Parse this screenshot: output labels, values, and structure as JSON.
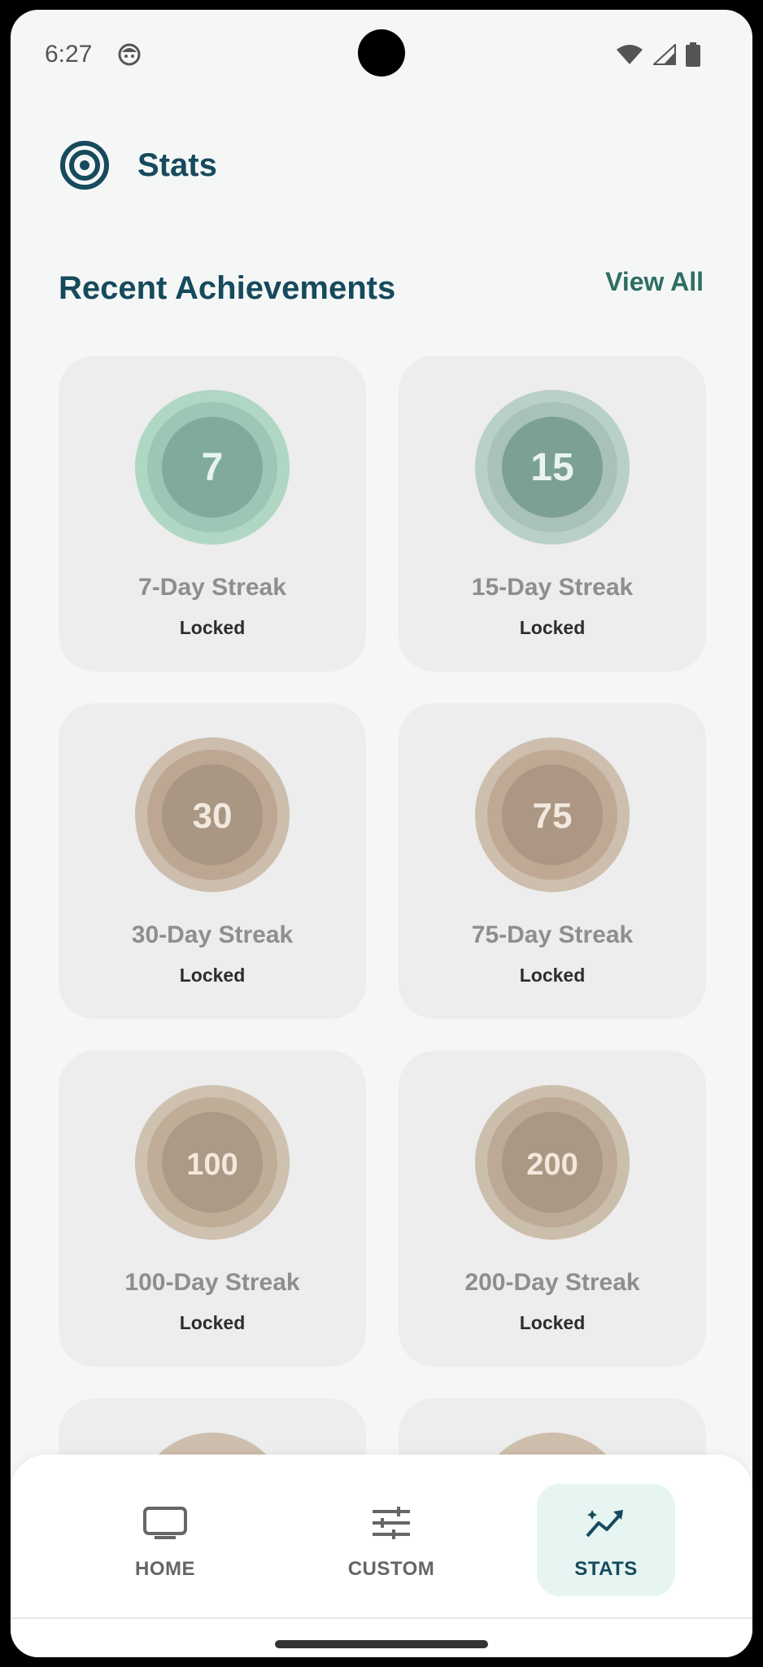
{
  "status_bar": {
    "time": "6:27"
  },
  "header": {
    "title": "Stats"
  },
  "section": {
    "title": "Recent Achievements",
    "view_all": "View All"
  },
  "achievements": [
    {
      "name": "7-Day Streak",
      "status": "Locked",
      "number": "7",
      "tint": "#a8d4c0"
    },
    {
      "name": "15-Day Streak",
      "status": "Locked",
      "number": "15",
      "tint": "#b4ccc2"
    },
    {
      "name": "30-Day Streak",
      "status": "Locked",
      "number": "30",
      "tint": "#c9b7a6"
    },
    {
      "name": "75-Day Streak",
      "status": "Locked",
      "number": "75",
      "tint": "#cbb8a6"
    },
    {
      "name": "100-Day Streak",
      "status": "Locked",
      "number": "100",
      "tint": "#cbbba8"
    },
    {
      "name": "200-Day Streak",
      "status": "Locked",
      "number": "200",
      "tint": "#c9b8a6"
    }
  ],
  "nav": [
    {
      "label": "HOME",
      "icon": "tv-icon",
      "active": false
    },
    {
      "label": "CUSTOM",
      "icon": "sliders-icon",
      "active": false
    },
    {
      "label": "STATS",
      "icon": "trending-up-icon",
      "active": true
    }
  ],
  "colors": {
    "primary": "#164a5c",
    "accent": "#2e6d62",
    "card": "#ecedec",
    "nav_active_bg": "#e6f5f2"
  }
}
